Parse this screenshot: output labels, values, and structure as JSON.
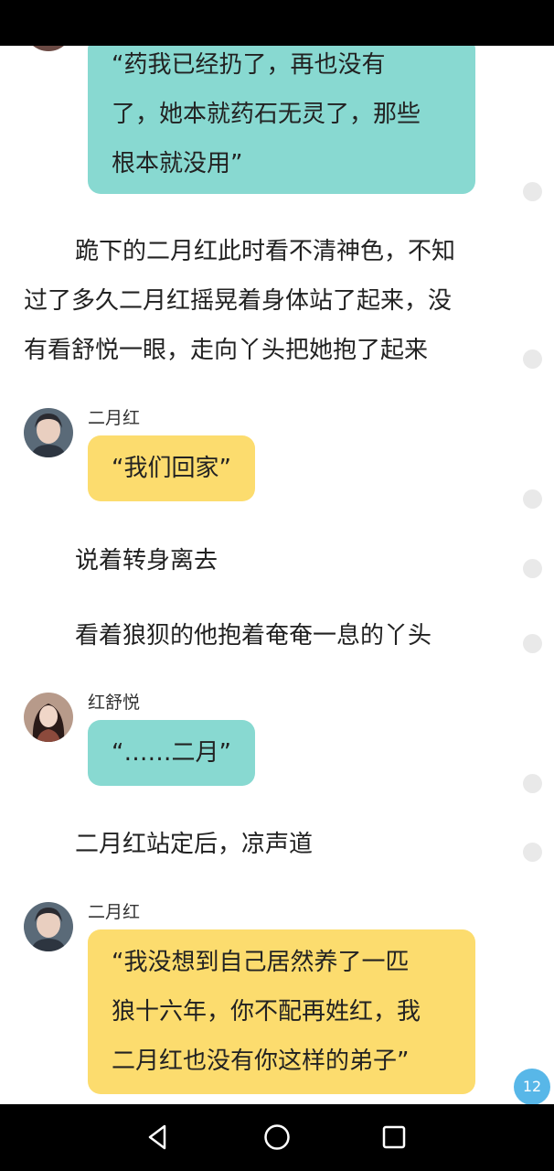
{
  "messages": {
    "m1_line1": "“药我已经扔了，再也没有",
    "m1_line2": "了，她本就药石无灵了，那些",
    "m1_line3": "根本就没用”",
    "narr1_line1": "跪下的二月红此时看不清神色，不知",
    "narr1_line2": "过了多久二月红摇晃着身体站了起来，没",
    "narr1_line3": "有看舒悦一眼，走向丫头把她抱了起来",
    "speaker1": "二月红",
    "m2": "“我们回家”",
    "narr2": "说着转身离去",
    "narr3": "看着狼狈的他抱着奄奄一息的丫头",
    "speaker2": "红舒悦",
    "m3": "“……二月”",
    "narr4": "二月红站定后，凉声道",
    "speaker3": "二月红",
    "m4_line1": "“我没想到自己居然养了一匹",
    "m4_line2": "狼十六年，你不配再姓红，我",
    "m4_line3": "二月红也没有你这样的弟子”"
  },
  "page_badge": "12",
  "colors": {
    "teal_bubble": "#88d9d1",
    "yellow_bubble": "#fcdc6e",
    "badge": "#58b7e8"
  },
  "icons": [
    "back-icon",
    "home-icon",
    "recents-icon"
  ]
}
